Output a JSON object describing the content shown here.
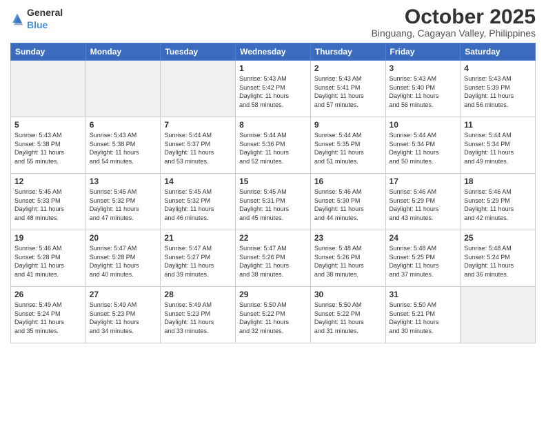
{
  "header": {
    "logo_general": "General",
    "logo_blue": "Blue",
    "month": "October 2025",
    "location": "Binguang, Cagayan Valley, Philippines"
  },
  "weekdays": [
    "Sunday",
    "Monday",
    "Tuesday",
    "Wednesday",
    "Thursday",
    "Friday",
    "Saturday"
  ],
  "weeks": [
    [
      {
        "day": "",
        "info": ""
      },
      {
        "day": "",
        "info": ""
      },
      {
        "day": "",
        "info": ""
      },
      {
        "day": "1",
        "info": "Sunrise: 5:43 AM\nSunset: 5:42 PM\nDaylight: 11 hours\nand 58 minutes."
      },
      {
        "day": "2",
        "info": "Sunrise: 5:43 AM\nSunset: 5:41 PM\nDaylight: 11 hours\nand 57 minutes."
      },
      {
        "day": "3",
        "info": "Sunrise: 5:43 AM\nSunset: 5:40 PM\nDaylight: 11 hours\nand 56 minutes."
      },
      {
        "day": "4",
        "info": "Sunrise: 5:43 AM\nSunset: 5:39 PM\nDaylight: 11 hours\nand 56 minutes."
      }
    ],
    [
      {
        "day": "5",
        "info": "Sunrise: 5:43 AM\nSunset: 5:38 PM\nDaylight: 11 hours\nand 55 minutes."
      },
      {
        "day": "6",
        "info": "Sunrise: 5:43 AM\nSunset: 5:38 PM\nDaylight: 11 hours\nand 54 minutes."
      },
      {
        "day": "7",
        "info": "Sunrise: 5:44 AM\nSunset: 5:37 PM\nDaylight: 11 hours\nand 53 minutes."
      },
      {
        "day": "8",
        "info": "Sunrise: 5:44 AM\nSunset: 5:36 PM\nDaylight: 11 hours\nand 52 minutes."
      },
      {
        "day": "9",
        "info": "Sunrise: 5:44 AM\nSunset: 5:35 PM\nDaylight: 11 hours\nand 51 minutes."
      },
      {
        "day": "10",
        "info": "Sunrise: 5:44 AM\nSunset: 5:34 PM\nDaylight: 11 hours\nand 50 minutes."
      },
      {
        "day": "11",
        "info": "Sunrise: 5:44 AM\nSunset: 5:34 PM\nDaylight: 11 hours\nand 49 minutes."
      }
    ],
    [
      {
        "day": "12",
        "info": "Sunrise: 5:45 AM\nSunset: 5:33 PM\nDaylight: 11 hours\nand 48 minutes."
      },
      {
        "day": "13",
        "info": "Sunrise: 5:45 AM\nSunset: 5:32 PM\nDaylight: 11 hours\nand 47 minutes."
      },
      {
        "day": "14",
        "info": "Sunrise: 5:45 AM\nSunset: 5:32 PM\nDaylight: 11 hours\nand 46 minutes."
      },
      {
        "day": "15",
        "info": "Sunrise: 5:45 AM\nSunset: 5:31 PM\nDaylight: 11 hours\nand 45 minutes."
      },
      {
        "day": "16",
        "info": "Sunrise: 5:46 AM\nSunset: 5:30 PM\nDaylight: 11 hours\nand 44 minutes."
      },
      {
        "day": "17",
        "info": "Sunrise: 5:46 AM\nSunset: 5:29 PM\nDaylight: 11 hours\nand 43 minutes."
      },
      {
        "day": "18",
        "info": "Sunrise: 5:46 AM\nSunset: 5:29 PM\nDaylight: 11 hours\nand 42 minutes."
      }
    ],
    [
      {
        "day": "19",
        "info": "Sunrise: 5:46 AM\nSunset: 5:28 PM\nDaylight: 11 hours\nand 41 minutes."
      },
      {
        "day": "20",
        "info": "Sunrise: 5:47 AM\nSunset: 5:28 PM\nDaylight: 11 hours\nand 40 minutes."
      },
      {
        "day": "21",
        "info": "Sunrise: 5:47 AM\nSunset: 5:27 PM\nDaylight: 11 hours\nand 39 minutes."
      },
      {
        "day": "22",
        "info": "Sunrise: 5:47 AM\nSunset: 5:26 PM\nDaylight: 11 hours\nand 38 minutes."
      },
      {
        "day": "23",
        "info": "Sunrise: 5:48 AM\nSunset: 5:26 PM\nDaylight: 11 hours\nand 38 minutes."
      },
      {
        "day": "24",
        "info": "Sunrise: 5:48 AM\nSunset: 5:25 PM\nDaylight: 11 hours\nand 37 minutes."
      },
      {
        "day": "25",
        "info": "Sunrise: 5:48 AM\nSunset: 5:24 PM\nDaylight: 11 hours\nand 36 minutes."
      }
    ],
    [
      {
        "day": "26",
        "info": "Sunrise: 5:49 AM\nSunset: 5:24 PM\nDaylight: 11 hours\nand 35 minutes."
      },
      {
        "day": "27",
        "info": "Sunrise: 5:49 AM\nSunset: 5:23 PM\nDaylight: 11 hours\nand 34 minutes."
      },
      {
        "day": "28",
        "info": "Sunrise: 5:49 AM\nSunset: 5:23 PM\nDaylight: 11 hours\nand 33 minutes."
      },
      {
        "day": "29",
        "info": "Sunrise: 5:50 AM\nSunset: 5:22 PM\nDaylight: 11 hours\nand 32 minutes."
      },
      {
        "day": "30",
        "info": "Sunrise: 5:50 AM\nSunset: 5:22 PM\nDaylight: 11 hours\nand 31 minutes."
      },
      {
        "day": "31",
        "info": "Sunrise: 5:50 AM\nSunset: 5:21 PM\nDaylight: 11 hours\nand 30 minutes."
      },
      {
        "day": "",
        "info": ""
      }
    ]
  ]
}
